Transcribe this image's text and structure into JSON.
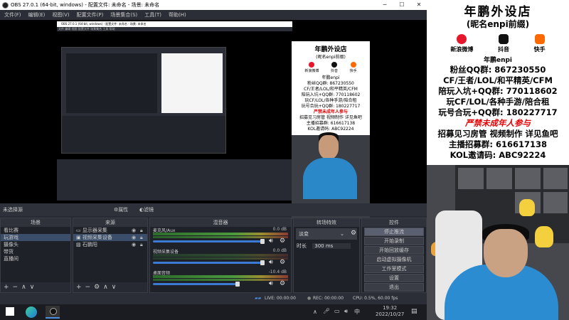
{
  "window": {
    "title": "OBS 27.0.1 (64-bit, windows) - 配置文件: 未命名 - 场景: 未命名",
    "minimize": "─",
    "maximize": "☐",
    "close": "✕"
  },
  "menu": [
    "文件(F)",
    "编辑(E)",
    "视图(V)",
    "配置文件(P)",
    "场景集合(S)",
    "工具(T)",
    "帮助(H)"
  ],
  "nested": {
    "title": "OBS 27.0.1 (64-bit, windows) - 配置文件: 未命名 - 场景: 未命名",
    "poster_title": "年鹏外设店",
    "poster_sub": "(昵名enpi前缀)",
    "icons": [
      "新浪微博",
      "抖音",
      "快手"
    ],
    "name": "年鹏enpi",
    "lines": [
      "粉丝QQ群: 867230550",
      "CF/王者/LOL/和平精英/CFM",
      "陪玩入坑+QQ群: 770118602",
      "玩CF/LOL/各种手游/陪合租",
      "玩号合玩+QQ群: 180227717"
    ],
    "red": "严禁未成年人参与",
    "recruit": "招募见习房管 视频制作 详见鱼吧",
    "anchor": "主播招募群: 616617138",
    "kol": "KOL邀请码: ABC92224"
  },
  "source_bar": {
    "label": "未选择源",
    "props": "⚙属性",
    "filters": "◐滤镜"
  },
  "scenes": {
    "header": "场景",
    "items": [
      "看比赛",
      "玩游戏",
      "摄像头",
      "带货",
      "直播间"
    ],
    "selected": 1
  },
  "sources": {
    "header": "来源",
    "items": [
      "显示器采集",
      "视频采集设备",
      "石鹏阳"
    ]
  },
  "mixer": {
    "header": "混音器",
    "channels": [
      {
        "name": "麦克风/Aux",
        "db": "0.0 dB"
      },
      {
        "name": "视频采集设备",
        "db": "0.0 dB"
      },
      {
        "name": "桌面音频",
        "db": "-10.4 dB"
      }
    ]
  },
  "transitions": {
    "header": "转场特效",
    "type": "淡变",
    "duration_label": "时长",
    "duration_value": "300 ms"
  },
  "controls": {
    "header": "控件",
    "buttons": [
      "停止推流",
      "开始录制",
      "开始回放缓存",
      "启动虚拟摄像机",
      "工作室模式",
      "设置",
      "退出"
    ]
  },
  "statusbar": {
    "live": "LIVE: 00:00:00",
    "rec": "REC: 00:00:00",
    "cpu": "CPU: 0.5%, 60.00 fps"
  },
  "taskbar": {
    "time": "19:32",
    "date": "2022/10/27"
  },
  "poster": {
    "title": "年鹏外设店",
    "subtitle": "(昵名enpi前缀)",
    "icons": [
      "新浪微博",
      "抖音",
      "快手"
    ],
    "name": "年鹏enpi",
    "lines": [
      "粉丝QQ群: 867230550",
      "CF/王者/LOL/和平精英/CFM",
      "陪玩入坑+QQ群: 770118602",
      "玩CF/LOL/各种手游/陪合租",
      "玩号合玩+QQ群: 180227717"
    ],
    "warning": "严禁未成年人参与",
    "recruit": "招募见习房管 视频制作 详见鱼吧",
    "anchor": "主播招募群: 616617138",
    "kol": "KOL邀请码: ABC92224"
  },
  "colors": {
    "accent_red": "#e40000",
    "shirt_blue": "#2b8cd2",
    "obs_bg": "#272a33"
  }
}
